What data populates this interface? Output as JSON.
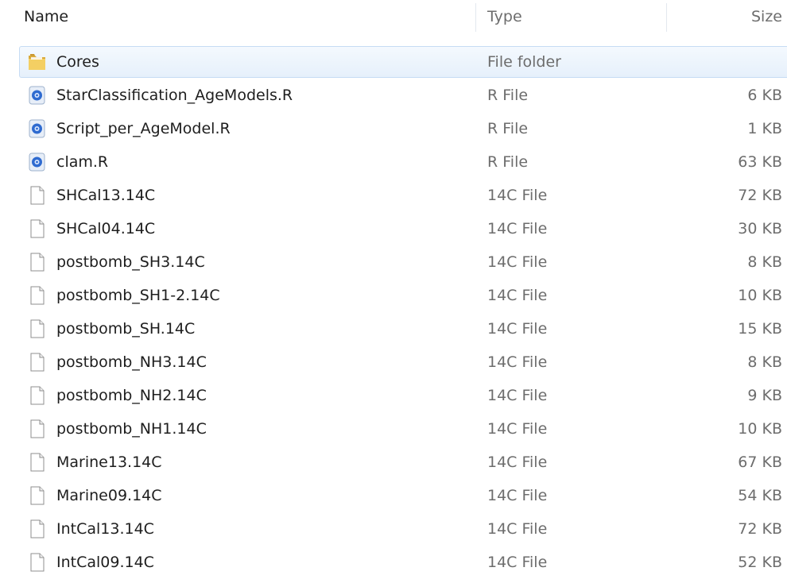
{
  "columns": {
    "name": "Name",
    "type": "Type",
    "size": "Size"
  },
  "files": [
    {
      "name": "Cores",
      "type": "File folder",
      "size": "",
      "icon": "folder-icon",
      "selected": true
    },
    {
      "name": "StarClassification_AgeModels.R",
      "type": "R File",
      "size": "6 KB",
      "icon": "r-script-icon"
    },
    {
      "name": "Script_per_AgeModel.R",
      "type": "R File",
      "size": "1 KB",
      "icon": "r-script-icon"
    },
    {
      "name": "clam.R",
      "type": "R File",
      "size": "63 KB",
      "icon": "r-script-icon"
    },
    {
      "name": "SHCal13.14C",
      "type": "14C File",
      "size": "72 KB",
      "icon": "blank-file-icon"
    },
    {
      "name": "SHCal04.14C",
      "type": "14C File",
      "size": "30 KB",
      "icon": "blank-file-icon"
    },
    {
      "name": "postbomb_SH3.14C",
      "type": "14C File",
      "size": "8 KB",
      "icon": "blank-file-icon"
    },
    {
      "name": "postbomb_SH1-2.14C",
      "type": "14C File",
      "size": "10 KB",
      "icon": "blank-file-icon"
    },
    {
      "name": "postbomb_SH.14C",
      "type": "14C File",
      "size": "15 KB",
      "icon": "blank-file-icon"
    },
    {
      "name": "postbomb_NH3.14C",
      "type": "14C File",
      "size": "8 KB",
      "icon": "blank-file-icon"
    },
    {
      "name": "postbomb_NH2.14C",
      "type": "14C File",
      "size": "9 KB",
      "icon": "blank-file-icon"
    },
    {
      "name": "postbomb_NH1.14C",
      "type": "14C File",
      "size": "10 KB",
      "icon": "blank-file-icon"
    },
    {
      "name": "Marine13.14C",
      "type": "14C File",
      "size": "67 KB",
      "icon": "blank-file-icon"
    },
    {
      "name": "Marine09.14C",
      "type": "14C File",
      "size": "54 KB",
      "icon": "blank-file-icon"
    },
    {
      "name": "IntCal13.14C",
      "type": "14C File",
      "size": "72 KB",
      "icon": "blank-file-icon"
    },
    {
      "name": "IntCal09.14C",
      "type": "14C File",
      "size": "52 KB",
      "icon": "blank-file-icon"
    }
  ]
}
